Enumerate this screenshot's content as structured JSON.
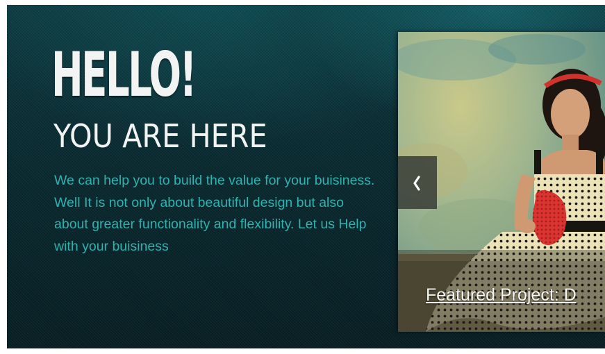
{
  "hero": {
    "headline": "HELLO!",
    "subheadline": "YOU ARE HERE",
    "intro_text": "We can help you to build the value for your buisiness. Well It is not only about beautiful design but also about greater functionality and flexibility. Let us Help with your buisiness"
  },
  "slider": {
    "caption": "Featured Project: D",
    "prev_icon": "chevron-left-icon",
    "image": "woman-in-polka-dot-dress-photo"
  },
  "colors": {
    "background": "#0a2b31",
    "headline": "#f2f4f4",
    "body_text": "#2fb3b0",
    "prev_button": "#373c37"
  }
}
